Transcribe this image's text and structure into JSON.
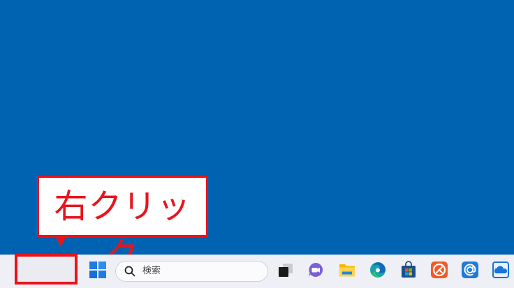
{
  "callout": {
    "text": "右クリック",
    "color": "#e8141c"
  },
  "desktop": {
    "background": "#0063b1"
  },
  "taskbar": {
    "search": {
      "placeholder": "検索"
    },
    "icons": [
      "windows-start-icon",
      "search-icon",
      "task-view-icon",
      "chat-icon",
      "file-explorer-icon",
      "edge-icon",
      "store-icon",
      "office-icon",
      "mail-icon",
      "onedrive-icon"
    ]
  }
}
